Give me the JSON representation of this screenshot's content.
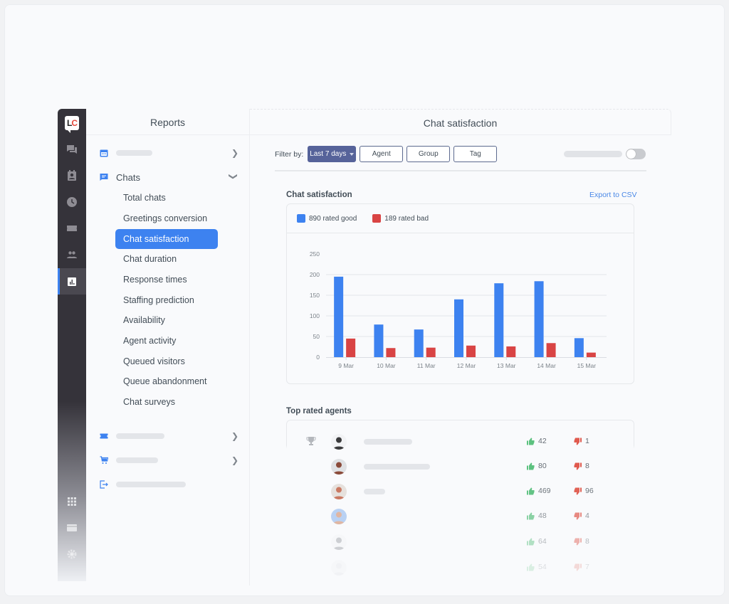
{
  "rail": {
    "logo": {
      "l": "L",
      "c": "C"
    },
    "items": [
      {
        "icon": "chats-icon"
      },
      {
        "icon": "customers-icon"
      },
      {
        "icon": "archives-icon"
      },
      {
        "icon": "tickets-icon"
      },
      {
        "icon": "agents-icon"
      },
      {
        "icon": "reports-icon",
        "active": true
      },
      {
        "icon": "apps-icon"
      },
      {
        "icon": "billing-icon"
      },
      {
        "icon": "settings-icon"
      }
    ]
  },
  "nav": {
    "title": "Reports",
    "groups": [
      {
        "icon": "calendar-icon",
        "label": "",
        "expanded": false
      },
      {
        "icon": "chats-icon",
        "label": "Chats",
        "expanded": true
      },
      {
        "icon": "tickets-icon",
        "label": "",
        "expanded": false
      },
      {
        "icon": "cart-icon",
        "label": "",
        "expanded": false
      },
      {
        "icon": "exit-icon",
        "label": ""
      }
    ],
    "chat_items": [
      "Total chats",
      "Greetings conversion",
      "Chat satisfaction",
      "Chat duration",
      "Response times",
      "Staffing prediction",
      "Availability",
      "Agent activity",
      "Queued visitors",
      "Queue abandonment",
      "Chat surveys"
    ],
    "active_item": "Chat satisfaction"
  },
  "main": {
    "title": "Chat satisfaction",
    "filter_label": "Filter by:",
    "filters": {
      "date": "Last 7 days",
      "agent": "Agent",
      "group": "Group",
      "tag": "Tag"
    },
    "toggle_on": false,
    "chart_section_title": "Chat satisfaction",
    "export_label": "Export to CSV",
    "agents_section_title": "Top rated agents"
  },
  "colors": {
    "good": "#3d82f0",
    "bad": "#d94444",
    "accent": "#3d82f0",
    "filter_primary": "#56639a"
  },
  "chart_data": {
    "type": "bar",
    "title": "Chat satisfaction",
    "xlabel": "",
    "ylabel": "",
    "categories": [
      "9 Mar",
      "10 Mar",
      "11 Mar",
      "12 Mar",
      "13 Mar",
      "14 Mar",
      "15 Mar"
    ],
    "series": [
      {
        "name": "890 rated good",
        "values": [
          195,
          79,
          67,
          140,
          179,
          184,
          46
        ]
      },
      {
        "name": "189 rated bad",
        "values": [
          45,
          22,
          23,
          28,
          26,
          34,
          11
        ]
      }
    ],
    "yticks": [
      0,
      50,
      100,
      150,
      200,
      250
    ],
    "ylim": [
      0,
      250
    ],
    "grid": true,
    "legend": "top-left"
  },
  "agents": [
    {
      "rank_icon": "trophy-icon",
      "good": "42",
      "bad": "1"
    },
    {
      "good": "80",
      "bad": "8"
    },
    {
      "good": "469",
      "bad": "96"
    },
    {
      "good": "48",
      "bad": "4"
    },
    {
      "good": "64",
      "bad": "8"
    },
    {
      "good": "54",
      "bad": "7"
    }
  ]
}
